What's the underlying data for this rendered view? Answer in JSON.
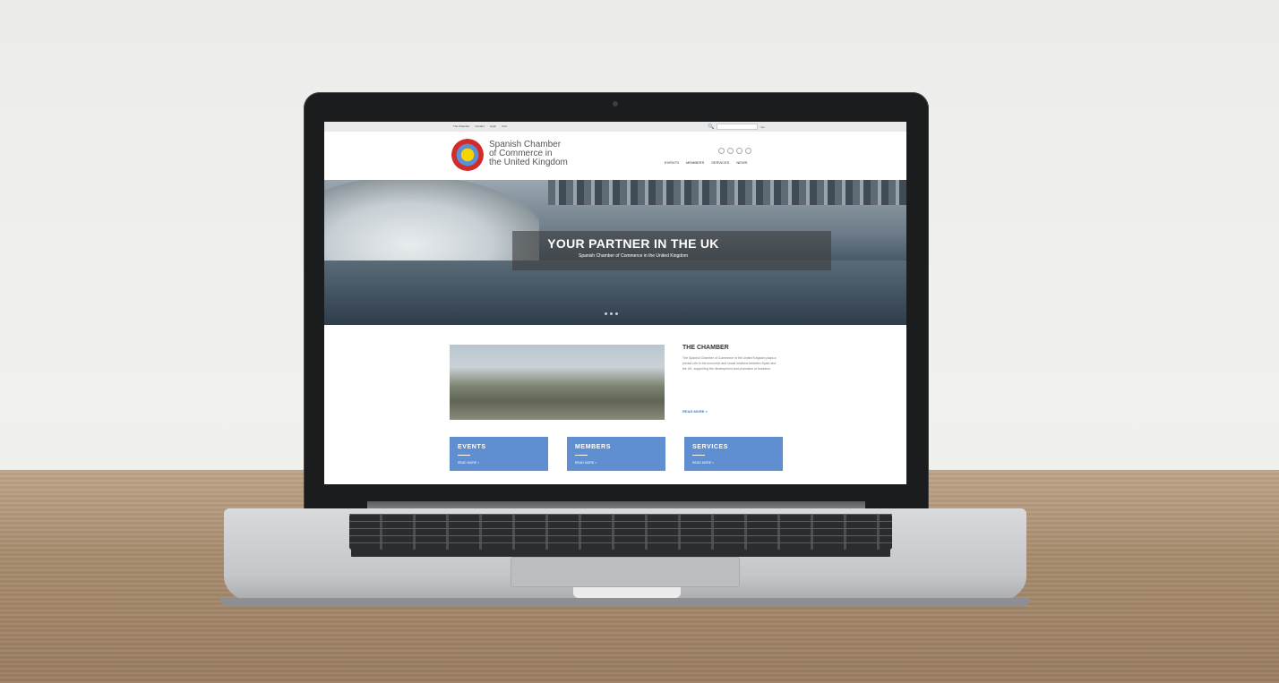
{
  "site": {
    "topbar": {
      "links": [
        "The Chamber",
        "Contact",
        "Login",
        "Cart"
      ],
      "search_placeholder": "",
      "search_button": "Go"
    },
    "brand": {
      "line1": "Spanish Chamber",
      "line2": "of Commerce in",
      "line3": "the United Kingdom"
    },
    "nav": [
      "EVENTS",
      "MEMBERS",
      "SERVICES",
      "NEWS"
    ],
    "hero": {
      "title": "YOUR PARTNER IN THE UK",
      "subtitle": "Spanish Chamber of Commerce in the United Kingdom"
    },
    "chamber": {
      "title": "THE CHAMBER",
      "text": "The Spanish Chamber of Commerce in the United Kingdom plays a pivotal role in the economic and social relations between Spain and the UK, supporting the development and promotion of business.",
      "read_more": "READ MORE >"
    },
    "cards": [
      {
        "title": "EVENTS",
        "link": "READ MORE >"
      },
      {
        "title": "MEMBERS",
        "link": "READ MORE >"
      },
      {
        "title": "SERVICES",
        "link": "READ MORE >"
      }
    ]
  },
  "colors": {
    "accent": "#5f8fd0",
    "logo_red": "#d32a2a",
    "logo_yellow": "#f7d300",
    "logo_blue": "#5b8fd6"
  }
}
